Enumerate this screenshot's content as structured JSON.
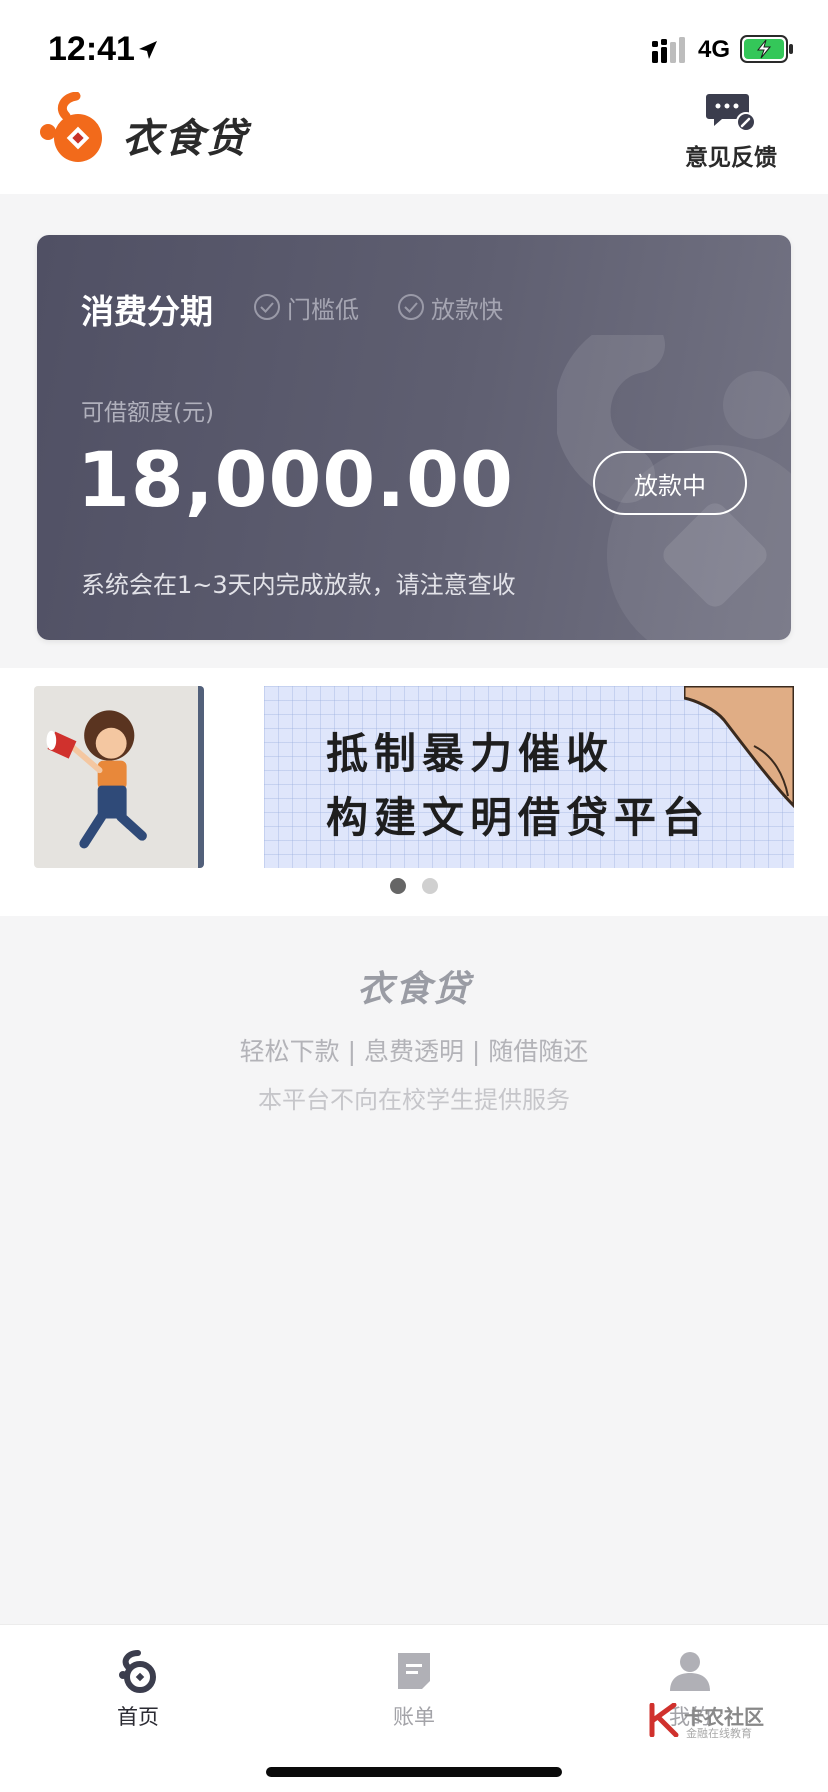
{
  "status_bar": {
    "time": "12:41",
    "network": "4G"
  },
  "header": {
    "logo_text": "衣食贷",
    "feedback_label": "意见反馈"
  },
  "card": {
    "title": "消费分期",
    "tags": [
      "门槛低",
      "放款快"
    ],
    "limit_label": "可借额度(元)",
    "limit_amount": "18,000.00",
    "status_button": "放款中",
    "note": "系统会在1~3天内完成放款，请注意查收"
  },
  "banner": {
    "line1": "抵制暴力催收",
    "line2": "构建文明借贷平台",
    "active_slide": 1,
    "slide_count": 2
  },
  "brand_footer": {
    "logo": "衣食贷",
    "slogan": "轻松下款 | 息费透明 | 随借随还",
    "disclaimer": "本平台不向在校学生提供服务"
  },
  "bottom_nav": {
    "items": [
      {
        "label": "首页",
        "icon": "home-icon",
        "active": true
      },
      {
        "label": "账单",
        "icon": "bill-icon",
        "active": false
      },
      {
        "label": "我的",
        "icon": "user-icon",
        "active": false
      }
    ]
  },
  "watermark": {
    "title": "卡农社区",
    "subtitle": "金融在线教育"
  },
  "colors": {
    "brand_orange": "#f26a1b",
    "card_gradient_start": "#505064",
    "card_gradient_end": "#737383"
  }
}
